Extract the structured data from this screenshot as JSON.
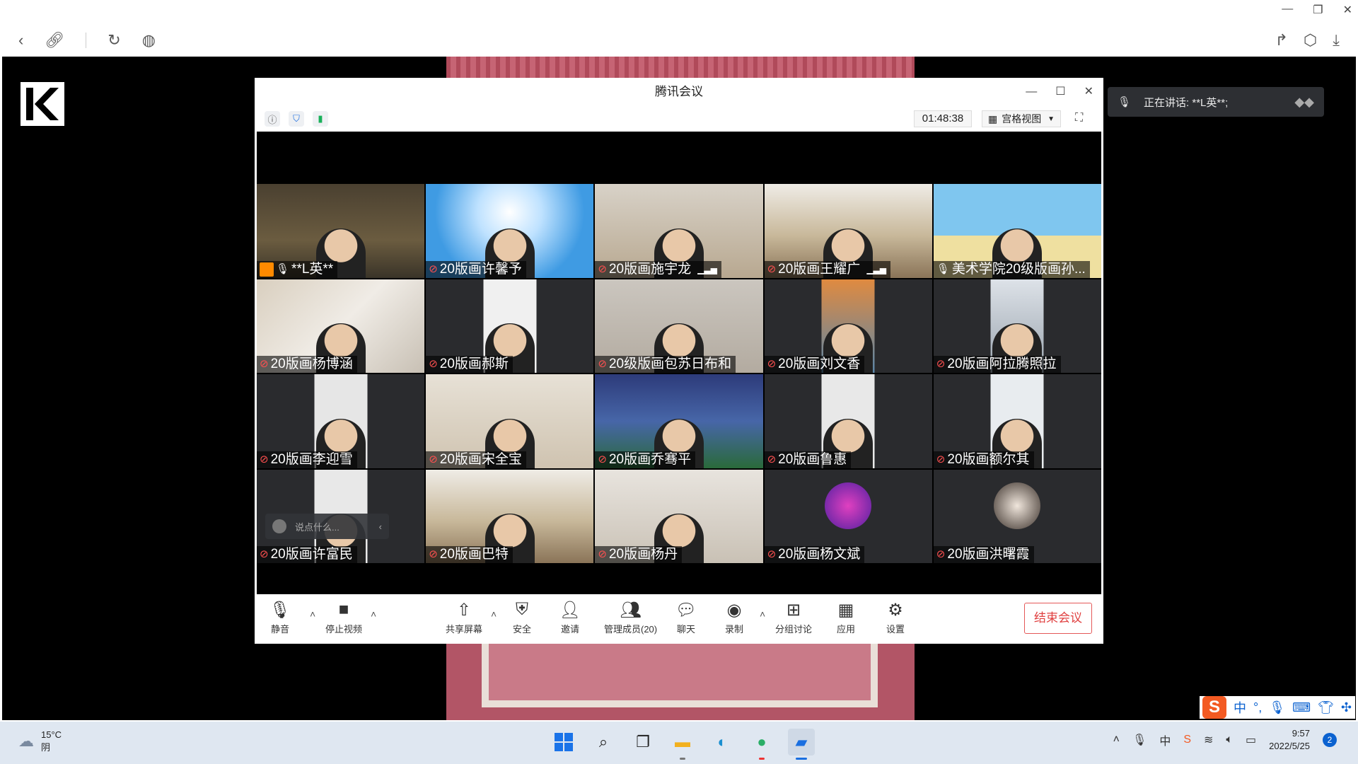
{
  "browser": {
    "window_controls": [
      "—",
      "❐",
      "✕"
    ]
  },
  "speaking": {
    "label": "正在讲话: **L英**;"
  },
  "meeting": {
    "title": "腾讯会议",
    "timer": "01:48:38",
    "view_mode": "宫格视图",
    "chat_placeholder": "说点什么...",
    "participants": [
      {
        "name": "**L英**",
        "mic": "on",
        "host": true,
        "signal": false
      },
      {
        "name": "20版画许馨予",
        "mic": "muted",
        "host": false,
        "signal": false
      },
      {
        "name": "20版画施宇龙",
        "mic": "muted",
        "host": false,
        "signal": true
      },
      {
        "name": "20版画王耀广",
        "mic": "muted",
        "host": false,
        "signal": true
      },
      {
        "name": "美术学院20级版画孙...",
        "mic": "on",
        "host": false,
        "signal": false
      },
      {
        "name": "20版画杨博涵",
        "mic": "muted",
        "host": false,
        "signal": false
      },
      {
        "name": "20版画郝斯",
        "mic": "muted",
        "host": false,
        "signal": false
      },
      {
        "name": "20级版画包苏日布和",
        "mic": "muted",
        "host": false,
        "signal": false
      },
      {
        "name": "20版画刘文香",
        "mic": "muted",
        "host": false,
        "signal": false
      },
      {
        "name": "20版画阿拉腾照拉",
        "mic": "muted",
        "host": false,
        "signal": false
      },
      {
        "name": "20版画李迎雪",
        "mic": "muted",
        "host": false,
        "signal": false
      },
      {
        "name": "20版画宋全宝",
        "mic": "muted",
        "host": false,
        "signal": false
      },
      {
        "name": "20版画乔骞平",
        "mic": "muted",
        "host": false,
        "signal": false
      },
      {
        "name": "20版画鲁惠",
        "mic": "muted",
        "host": false,
        "signal": false
      },
      {
        "name": "20版画额尔其",
        "mic": "muted",
        "host": false,
        "signal": false
      },
      {
        "name": "20版画许富民",
        "mic": "muted",
        "host": false,
        "signal": false
      },
      {
        "name": "20版画巴特",
        "mic": "muted",
        "host": false,
        "signal": false
      },
      {
        "name": "20版画杨丹",
        "mic": "muted",
        "host": false,
        "signal": false
      },
      {
        "name": "20版画杨文斌",
        "mic": "muted",
        "host": false,
        "signal": false
      },
      {
        "name": "20版画洪曙霞",
        "mic": "muted",
        "host": false,
        "signal": false
      }
    ],
    "toolbar": {
      "mute": "静音",
      "stop_video": "停止视频",
      "share_screen": "共享屏幕",
      "security": "安全",
      "invite": "邀请",
      "manage_members": "管理成员(20)",
      "chat": "聊天",
      "record": "录制",
      "breakout": "分组讨论",
      "apps": "应用",
      "settings": "设置",
      "end_meeting": "结束会议"
    }
  },
  "ime": {
    "mode": "中"
  },
  "taskbar": {
    "temperature": "15°C",
    "weather": "阴",
    "time": "9:57",
    "date": "2022/5/25",
    "notifications": "2"
  },
  "colors": {
    "end_button": "#e04040",
    "muted_mic": "#ff5050",
    "host_badge": "#ff8a00"
  }
}
